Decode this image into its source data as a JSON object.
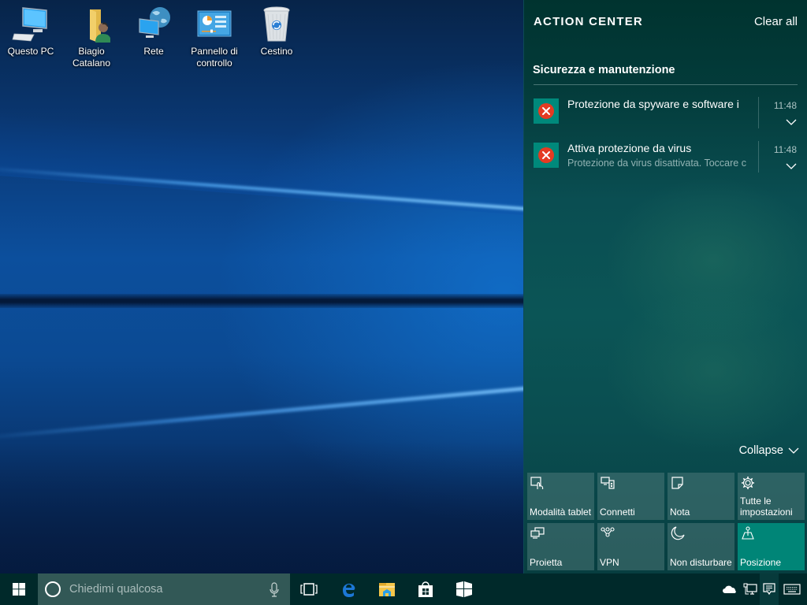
{
  "desktop": {
    "icons": [
      {
        "label": "Questo PC",
        "icon": "computer-icon"
      },
      {
        "label": "Biagio Catalano",
        "icon": "user-folder-icon"
      },
      {
        "label": "Rete",
        "icon": "network-icon"
      },
      {
        "label": "Pannello di controllo",
        "icon": "control-panel-icon"
      },
      {
        "label": "Cestino",
        "icon": "recycle-bin-icon"
      }
    ]
  },
  "action_center": {
    "title": "ACTION CENTER",
    "clear_all": "Clear all",
    "groups": [
      {
        "title": "Sicurezza e manutenzione",
        "notifications": [
          {
            "title": "Protezione da spyware e software i",
            "body": "",
            "time": "11:48",
            "icon": "error-icon"
          },
          {
            "title": "Attiva protezione da virus",
            "body": "Protezione da virus disattivata. Toccare c",
            "time": "11:48",
            "icon": "error-icon"
          }
        ]
      }
    ],
    "collapse_label": "Collapse",
    "quick_actions": [
      {
        "label": "Modalità tablet",
        "icon": "tablet-mode-icon",
        "active": false
      },
      {
        "label": "Connetti",
        "icon": "connect-icon",
        "active": false
      },
      {
        "label": "Nota",
        "icon": "note-icon",
        "active": false
      },
      {
        "label": "Tutte le impostazioni",
        "icon": "settings-gear-icon",
        "active": false
      },
      {
        "label": "Proietta",
        "icon": "project-icon",
        "active": false
      },
      {
        "label": "VPN",
        "icon": "vpn-icon",
        "active": false
      },
      {
        "label": "Non disturbare",
        "icon": "moon-icon",
        "active": false
      },
      {
        "label": "Posizione",
        "icon": "location-icon",
        "active": true
      }
    ],
    "colors": {
      "active_tile": "#008577",
      "error_badge": "#e53b22",
      "app_icon_bg": "#00897b"
    }
  },
  "taskbar": {
    "search_placeholder": "Chiedimi qualcosa",
    "pinned": [
      {
        "name": "Task View",
        "icon": "task-view-icon"
      },
      {
        "name": "Microsoft Edge",
        "icon": "edge-icon"
      },
      {
        "name": "Esplora file",
        "icon": "file-explorer-icon"
      },
      {
        "name": "Store",
        "icon": "store-icon"
      },
      {
        "name": "App",
        "icon": "app-tile-icon"
      }
    ],
    "tray": [
      {
        "name": "OneDrive",
        "icon": "onedrive-icon"
      },
      {
        "name": "Rete",
        "icon": "network-wired-icon"
      },
      {
        "name": "Centro notifiche",
        "icon": "action-center-icon"
      },
      {
        "name": "Tastiera touch",
        "icon": "keyboard-icon"
      }
    ]
  }
}
